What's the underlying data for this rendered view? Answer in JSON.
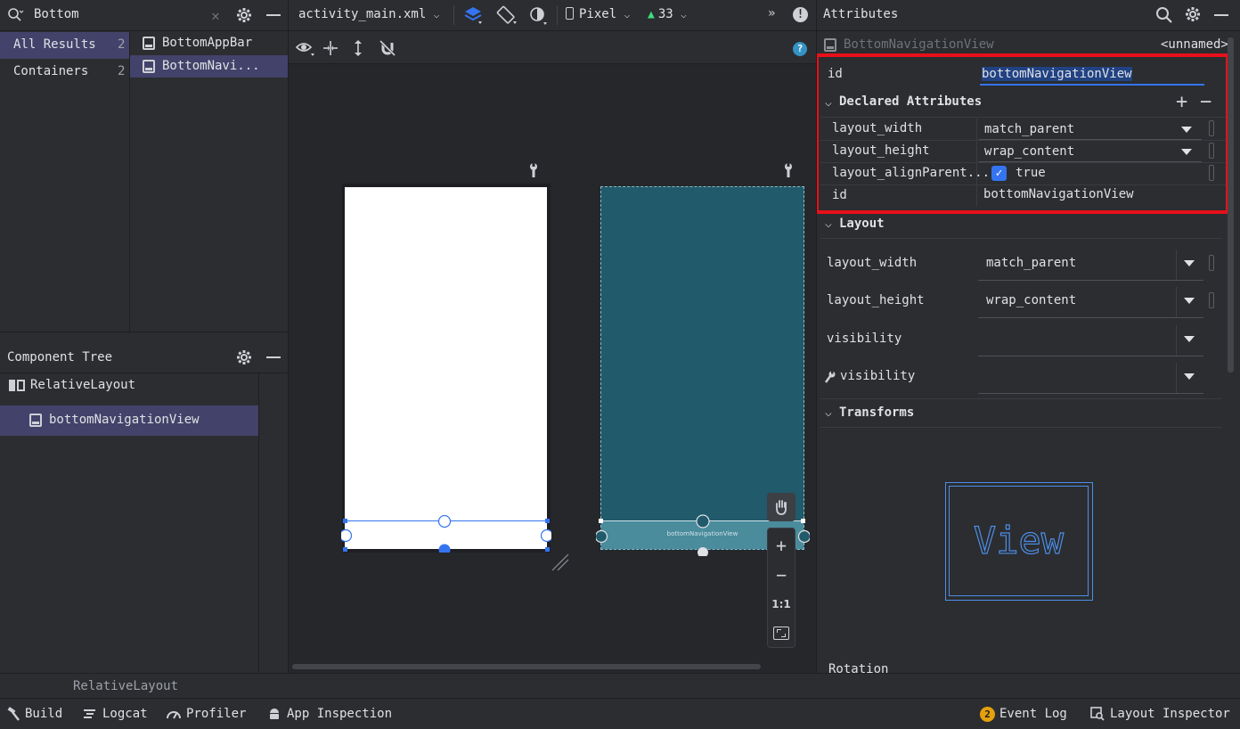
{
  "palette": {
    "search_query": "Bottom",
    "results_all_label": "All Results",
    "results_all_count": "2",
    "results_containers_label": "Containers",
    "results_containers_count": "2",
    "items": [
      "BottomAppBar",
      "BottomNavi..."
    ]
  },
  "component_tree": {
    "title": "Component Tree",
    "root": "RelativeLayout",
    "child": "bottomNavigationView"
  },
  "editor": {
    "file_tab": "activity_main.xml",
    "device": "Pixel",
    "api": "33",
    "blueprint_label": "bottomNavigationView",
    "zoom_reset": "1:1",
    "breadcrumb": "RelativeLayout"
  },
  "attributes": {
    "title": "Attributes",
    "view_type": "BottomNavigationView",
    "view_name": "<unnamed>",
    "id_label": "id",
    "id_value": "bottomNavigationView",
    "declared_title": "Declared Attributes",
    "declared": [
      {
        "name": "layout_width",
        "value": "match_parent"
      },
      {
        "name": "layout_height",
        "value": "wrap_content"
      },
      {
        "name": "layout_alignParent...",
        "value": "true"
      },
      {
        "name": "id",
        "value": "bottomNavigationView"
      }
    ],
    "layout_title": "Layout",
    "layout": [
      {
        "name": "layout_width",
        "value": "match_parent"
      },
      {
        "name": "layout_height",
        "value": "wrap_content"
      },
      {
        "name": "visibility",
        "value": ""
      },
      {
        "name": "visibility",
        "value": ""
      }
    ],
    "transforms_title": "Transforms",
    "preview_text": "View",
    "rotation_label": "Rotation"
  },
  "bottom_bar": {
    "build": "Build",
    "logcat": "Logcat",
    "profiler": "Profiler",
    "app_inspection": "App Inspection",
    "event_log_badge": "2",
    "event_log": "Event Log",
    "layout_inspector": "Layout Inspector"
  },
  "colors": {
    "highlight_red": "#e8101a",
    "selection": "#43426a",
    "accent_blue": "#3574f0",
    "blueprint": "#205a6b"
  }
}
